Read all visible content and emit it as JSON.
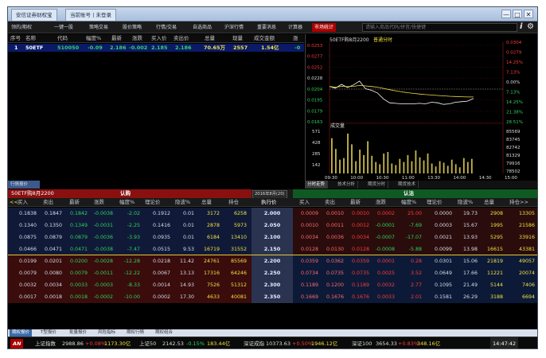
{
  "titlebar": {
    "tabs": [
      "安信证券财权宝",
      "当前账号丨未登录"
    ],
    "win_min": "—",
    "win_max": "□",
    "win_close": "✕"
  },
  "menu": {
    "items": [
      "领的/期权",
      "一键一股",
      "策略交易",
      "股价策略",
      "行情/交易",
      "自选商品",
      "沪深行情",
      "重要消息",
      "计算器"
    ],
    "active": "市场统计",
    "search_placeholder": "请输入商品代码/拼音/快捷键",
    "info_icon": "i"
  },
  "watchlist": {
    "headers": [
      "序号",
      "名称",
      "代码",
      "幅度%",
      "最新",
      "涨跌",
      "买入价",
      "卖出价",
      "总量",
      "现量",
      "成交金额",
      "涨"
    ],
    "row": {
      "idx": "1",
      "name": "50ETF",
      "code": "510050",
      "chg_pct": "-0.09",
      "last": "2.186",
      "change": "-0.002",
      "bid": "2.185",
      "ask": "2.186",
      "volume": "70.65万",
      "cur_vol": "2557",
      "amount": "1.54亿",
      "extra": "-0"
    }
  },
  "chart": {
    "title": "50ETF购8月2200",
    "subtitle": "普通分时",
    "vol_label": "成交量",
    "price_ticks": [
      "0.0253",
      "0.0277",
      "0.0252",
      "0.0228",
      "0.0204",
      "0.0195",
      "0.0179",
      "0.0163"
    ],
    "pct_ticks": [
      "21.38%",
      "14.25%",
      "7.13%",
      "0.00%",
      "7.13%",
      "14.25%",
      "21.38%",
      "28.51%"
    ],
    "right_ticks": [
      "0.0304",
      "0.0279",
      "14.25%",
      "7.13%",
      "0.00%",
      "7.13%",
      "14.25%",
      "21.38%",
      "28.51%"
    ],
    "vol_ticks": [
      "571",
      "428",
      "285",
      "142"
    ],
    "vol_right": [
      "85569",
      "83745",
      "82742",
      "81329",
      "79916",
      "78502"
    ],
    "time_ticks": [
      "09:30",
      "10:00",
      "10:30",
      "11:00",
      "13:30",
      "14:00",
      "14:30",
      "15:00"
    ]
  },
  "chart_tabs": [
    "分时走势",
    "技术分析",
    "期货分时",
    "期货技术"
  ],
  "left_strip": "行情报价",
  "optionboard": {
    "call_title": "认购",
    "put_title": "认沽",
    "contract": "50ETF购8月2200",
    "month": "2016年8月(20)",
    "nav": "<<",
    "call_headers": [
      "买入",
      "卖出",
      "最新",
      "涨跌",
      "幅度%",
      "理论价",
      "隐波%",
      "总量",
      "持仓"
    ],
    "strike_header": "执行价",
    "put_headers": [
      "买入",
      "卖出",
      "最新",
      "涨跌",
      "幅度%",
      "理论价",
      "隐波%",
      "总量",
      "持仓>>"
    ],
    "rows": [
      {
        "c": [
          "0.1838",
          "0.1847",
          "0.1842",
          "-0.0038",
          "-2.02",
          "0.1912",
          "0.01",
          "3172",
          "6258"
        ],
        "k": "2.000",
        "p": [
          "0.0009",
          "0.0010",
          "0.0010",
          "0.0002",
          "25.00",
          "0.0000",
          "19.73",
          "2908",
          "13305"
        ]
      },
      {
        "c": [
          "0.1340",
          "0.1350",
          "0.1349",
          "-0.0031",
          "-2.25",
          "0.1416",
          "0.01",
          "2878",
          "5973"
        ],
        "k": "2.050",
        "p": [
          "0.0010",
          "0.0011",
          "0.0012",
          "-0.0001",
          "-7.69",
          "0.0003",
          "15.67",
          "1995",
          "21586"
        ]
      },
      {
        "c": [
          "0.0875",
          "0.0879",
          "0.0879",
          "-0.0036",
          "-3.93",
          "0.0935",
          "0.01",
          "6184",
          "13410"
        ],
        "k": "2.100",
        "p": [
          "0.0034",
          "0.0036",
          "0.0034",
          "-0.0007",
          "-17.07",
          "0.0021",
          "13.93",
          "5295",
          "33916"
        ]
      },
      {
        "c": [
          "0.0466",
          "0.0471",
          "0.0471",
          "-0.0038",
          "-7.47",
          "0.0515",
          "9.53",
          "16719",
          "31552"
        ],
        "k": "2.150",
        "p": [
          "0.0128",
          "0.0130",
          "0.0128",
          "-0.0008",
          "-5.88",
          "0.0099",
          "13.98",
          "16615",
          "43381"
        ]
      },
      {
        "c": [
          "0.0199",
          "0.0201",
          "0.0200",
          "-0.0028",
          "-12.28",
          "0.0218",
          "11.42",
          "24761",
          "85569"
        ],
        "k": "2.200",
        "p": [
          "0.0359",
          "0.0362",
          "0.0359",
          "0.0001",
          "0.28",
          "0.0301",
          "15.06",
          "21819",
          "49057"
        ]
      },
      {
        "c": [
          "0.0079",
          "0.0080",
          "0.0079",
          "-0.0011",
          "-12.22",
          "0.0067",
          "13.13",
          "17316",
          "64246"
        ],
        "k": "2.250",
        "p": [
          "0.0734",
          "0.0735",
          "0.0735",
          "0.0025",
          "3.52",
          "0.0649",
          "17.66",
          "11221",
          "20074"
        ]
      },
      {
        "c": [
          "0.0032",
          "0.0034",
          "0.0033",
          "-0.0003",
          "-8.33",
          "0.0014",
          "14.93",
          "7526",
          "51312"
        ],
        "k": "2.300",
        "p": [
          "0.1189",
          "0.1200",
          "0.1189",
          "0.0032",
          "2.77",
          "0.1095",
          "21.49",
          "5144",
          "7406"
        ]
      },
      {
        "c": [
          "0.0017",
          "0.0018",
          "0.0018",
          "-0.0002",
          "-10.00",
          "0.0002",
          "17.30",
          "4633",
          "40081"
        ],
        "k": "2.350",
        "p": [
          "0.1669",
          "0.1676",
          "0.1676",
          "0.0033",
          "2.01",
          "0.1581",
          "26.29",
          "3188",
          "6694"
        ]
      }
    ]
  },
  "bottom_tabs": [
    "期权报价",
    "T型报价",
    "批量报价",
    "风险指标",
    "期权行情",
    "期权组合"
  ],
  "statusbar": {
    "logo": "AN",
    "sh_label": "上证指数",
    "sh_value": "2988.86",
    "sh_pct": "+0.08%",
    "sh_amt": "1173.30亿",
    "sz50_label": "上证50",
    "sz50_value": "2142.53",
    "sz50_pct": "-0.15%",
    "sz50_amt": "183.44亿",
    "szcz_label": "深证成指",
    "szcz_value": "10373.63",
    "szcz_pct": "+0.50%",
    "szcz_amt": "1946.12亿",
    "sz100_label": "深证100",
    "sz100_value": "3654.33",
    "sz100_pct": "+0.83%",
    "sz100_amt": "348.16亿",
    "time": "14:47:42"
  },
  "colors": {
    "up": "#ff3b3b",
    "down": "#2fd25a",
    "yellow": "#f0e040",
    "chart_bar": "#c8b84a",
    "avg": "#f0e040",
    "price": "#ffffff"
  },
  "chart_data": {
    "type": "line",
    "price_series": [
      0.0228,
      0.0225,
      0.0232,
      0.0226,
      0.0231,
      0.0238,
      0.0224,
      0.0221,
      0.0216,
      0.0205,
      0.0198,
      0.0197,
      0.0196,
      0.0196,
      0.0196,
      0.0197,
      0.0196,
      0.0199,
      0.0198,
      0.0195,
      0.0196,
      0.0199,
      0.02,
      0.0201,
      0.0206
    ],
    "volume_series": [
      460,
      320,
      180,
      200,
      520,
      380,
      160,
      310,
      240,
      420,
      230,
      150,
      120,
      260,
      280,
      130,
      110,
      190,
      150,
      240,
      160,
      300,
      210,
      170,
      260,
      130,
      90,
      160,
      140,
      100,
      180,
      120,
      80,
      200,
      150,
      190
    ],
    "y_range": [
      0.0163,
      0.0304
    ],
    "vol_range": [
      0,
      571
    ]
  }
}
